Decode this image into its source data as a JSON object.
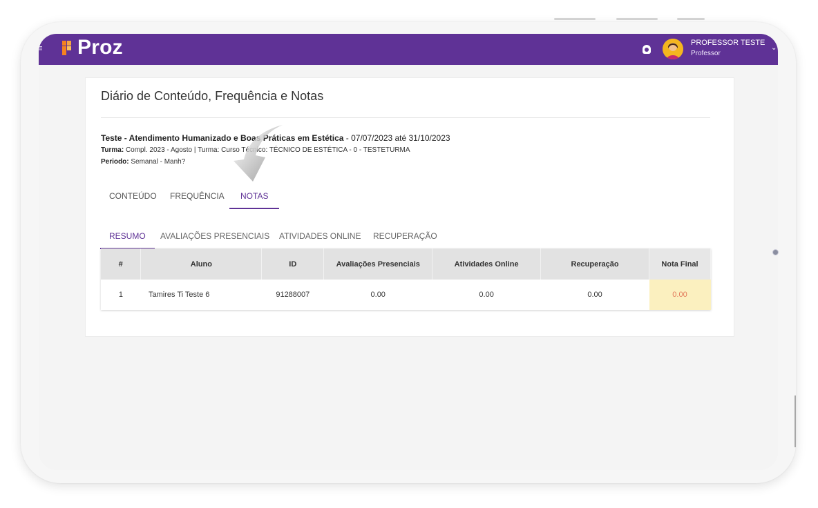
{
  "header": {
    "logo_text": "Proz",
    "user_name": "PROFESSOR TESTE",
    "user_role": "Professor",
    "brand_color": "#5f3296"
  },
  "page": {
    "title": "Diário de Conteúdo, Frequência e Notas",
    "course_name": "Teste - Atendimento Humanizado e Boas Práticas em Estética",
    "course_dates": " - 07/07/2023 até 31/10/2023",
    "turma_label": "Turma:",
    "turma_value": "Compl. 2023 - Agosto | Turma: Curso Técnico: TÉCNICO DE ESTÉTICA - 0 - TESTETURMA",
    "periodo_label": "Periodo:",
    "periodo_value": "Semanal - Manh?"
  },
  "main_tabs": [
    {
      "label": "CONTEÚDO",
      "active": false
    },
    {
      "label": "FREQUÊNCIA",
      "active": false
    },
    {
      "label": "NOTAS",
      "active": true
    }
  ],
  "sub_tabs": [
    {
      "label": "RESUMO",
      "active": true
    },
    {
      "label": "AVALIAÇÕES PRESENCIAIS",
      "active": false
    },
    {
      "label": "ATIVIDADES ONLINE",
      "active": false
    },
    {
      "label": "RECUPERAÇÃO",
      "active": false
    }
  ],
  "table": {
    "headers": [
      "#",
      "Aluno",
      "ID",
      "Avaliações Presenciais",
      "Atividades Online",
      "Recuperação",
      "Nota Final"
    ],
    "rows": [
      [
        "1",
        "Tamires Ti Teste 6",
        "91288007",
        "0.00",
        "0.00",
        "0.00",
        "0.00"
      ]
    ]
  },
  "icons": {
    "menu": "menu-icon",
    "bell": "bell-icon",
    "avatar": "avatar",
    "dropdown": "chevron-down-icon",
    "hint": "arrow-pointer-icon"
  },
  "colors": {
    "final_grade_bg": "#fbf0bf",
    "final_grade_text": "#e2795a"
  }
}
